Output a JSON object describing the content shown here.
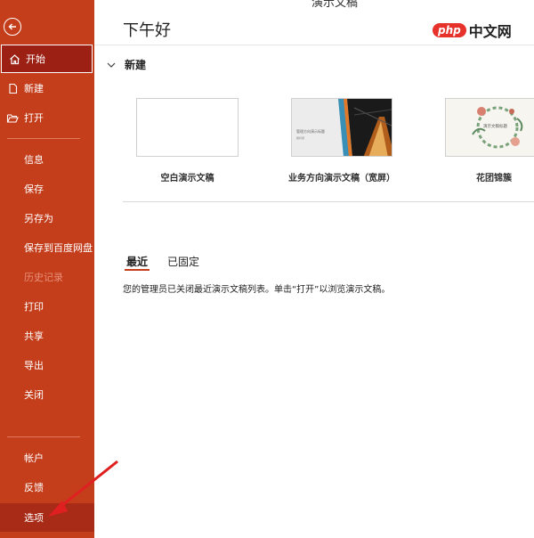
{
  "sidebar": {
    "items": [
      {
        "label": "开始",
        "icon": "home-icon"
      },
      {
        "label": "新建",
        "icon": "new-file-icon"
      },
      {
        "label": "打开",
        "icon": "folder-open-icon"
      },
      {
        "label": "信息"
      },
      {
        "label": "保存"
      },
      {
        "label": "另存为"
      },
      {
        "label": "保存到百度网盘"
      },
      {
        "label": "历史记录"
      },
      {
        "label": "打印"
      },
      {
        "label": "共享"
      },
      {
        "label": "导出"
      },
      {
        "label": "关闭"
      },
      {
        "label": "帐户"
      },
      {
        "label": "反馈"
      },
      {
        "label": "选项"
      }
    ],
    "active_item": "开始",
    "selected_item": "选项",
    "disabled_item": "历史记录"
  },
  "window": {
    "title_partial": "演示文稿"
  },
  "main": {
    "greeting": "下午好",
    "new_section": {
      "title": "新建",
      "templates": [
        {
          "label": "空白演示文稿",
          "thumb_text": ""
        },
        {
          "label": "业务方向演示文稿（宽屏）",
          "thumb_text": "管理方向演示标题",
          "thumb_subtext": "副标题"
        },
        {
          "label": "花团锦簇",
          "thumb_text": "演示文稿标题"
        }
      ]
    },
    "tabs": [
      {
        "label": "最近"
      },
      {
        "label": "已固定"
      }
    ],
    "active_tab": "最近",
    "message": "您的管理员已关闭最近演示文稿列表。单击“打开”以浏览演示文稿。"
  },
  "watermark": {
    "badge": "php",
    "text": "中文网"
  },
  "colors": {
    "sidebar": "#c43e1c",
    "active": "#9c2014",
    "accent": "#c43e1c",
    "arrow": "#e02020"
  }
}
